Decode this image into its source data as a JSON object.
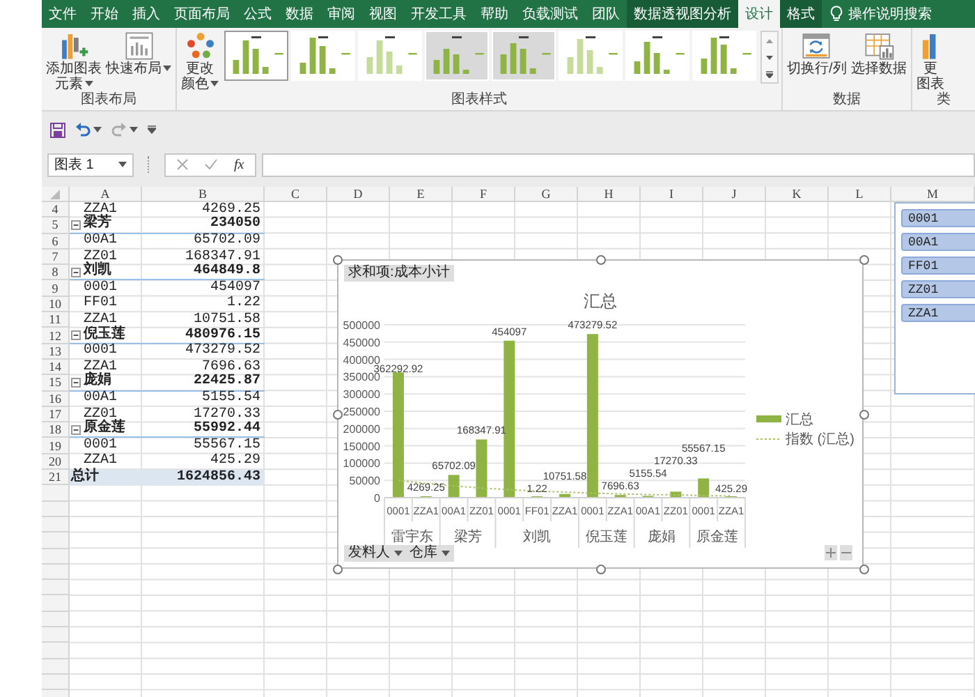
{
  "ribbon_tabs": [
    {
      "label": "文件",
      "selected": false,
      "contextual": false
    },
    {
      "label": "开始",
      "selected": false,
      "contextual": false
    },
    {
      "label": "插入",
      "selected": false,
      "contextual": false
    },
    {
      "label": "页面布局",
      "selected": false,
      "contextual": false
    },
    {
      "label": "公式",
      "selected": false,
      "contextual": false
    },
    {
      "label": "数据",
      "selected": false,
      "contextual": false
    },
    {
      "label": "审阅",
      "selected": false,
      "contextual": false
    },
    {
      "label": "视图",
      "selected": false,
      "contextual": false
    },
    {
      "label": "开发工具",
      "selected": false,
      "contextual": false
    },
    {
      "label": "帮助",
      "selected": false,
      "contextual": false
    },
    {
      "label": "负载测试",
      "selected": false,
      "contextual": false
    },
    {
      "label": "团队",
      "selected": false,
      "contextual": false
    },
    {
      "label": "数据透视图分析",
      "selected": false,
      "contextual": true
    },
    {
      "label": "设计",
      "selected": true,
      "contextual": true
    },
    {
      "label": "格式",
      "selected": false,
      "contextual": true
    }
  ],
  "tell_me": {
    "label": "操作说明搜索"
  },
  "ribbon_groups": [
    {
      "label": "图表布局",
      "buttons": [
        {
          "kind": "add",
          "lines": [
            "添加图表",
            "元素"
          ],
          "dropdown": true
        },
        {
          "kind": "layout",
          "lines": [
            "快速布局"
          ],
          "dropdown": true
        }
      ]
    },
    {
      "label": "图表样式",
      "buttons": [
        {
          "kind": "colors",
          "lines": [
            "更改",
            "颜色"
          ],
          "dropdown": true
        }
      ],
      "styles": [
        {
          "selected": true
        },
        {
          "selected": false
        },
        {
          "selected": false
        },
        {
          "selected": false
        },
        {
          "selected": false
        },
        {
          "selected": false
        },
        {
          "selected": false
        },
        {
          "selected": false
        }
      ]
    },
    {
      "label": "数据",
      "buttons": [
        {
          "kind": "switch",
          "lines": [
            "切换行/列"
          ],
          "dropdown": false
        },
        {
          "kind": "select",
          "lines": [
            "选择数据"
          ],
          "dropdown": false
        }
      ]
    },
    {
      "label": "类",
      "buttons": [
        {
          "kind": "type",
          "lines": [
            "更",
            "图表"
          ],
          "dropdown": false
        }
      ]
    }
  ],
  "formula_bar": {
    "name_box": "图表 1",
    "function_label": "fx"
  },
  "columns": [
    "A",
    "B",
    "C",
    "D",
    "E",
    "F",
    "G",
    "H",
    "I",
    "J",
    "K",
    "L",
    "M"
  ],
  "rows": [
    {
      "number": "4",
      "label": "ZZA1",
      "value": "4269.25",
      "kind": "item"
    },
    {
      "number": "5",
      "label": "梁芳",
      "value": "234050",
      "kind": "group",
      "expanded": true
    },
    {
      "number": "6",
      "label": "00A1",
      "value": "65702.09",
      "kind": "item"
    },
    {
      "number": "7",
      "label": "ZZ01",
      "value": "168347.91",
      "kind": "item"
    },
    {
      "number": "8",
      "label": "刘凯",
      "value": "464849.8",
      "kind": "group",
      "expanded": true
    },
    {
      "number": "9",
      "label": "0001",
      "value": "454097",
      "kind": "item"
    },
    {
      "number": "10",
      "label": "FF01",
      "value": "1.22",
      "kind": "item"
    },
    {
      "number": "11",
      "label": "ZZA1",
      "value": "10751.58",
      "kind": "item"
    },
    {
      "number": "12",
      "label": "倪玉莲",
      "value": "480976.15",
      "kind": "group",
      "expanded": true
    },
    {
      "number": "13",
      "label": "0001",
      "value": "473279.52",
      "kind": "item"
    },
    {
      "number": "14",
      "label": "ZZA1",
      "value": "7696.63",
      "kind": "item"
    },
    {
      "number": "15",
      "label": "庞娟",
      "value": "22425.87",
      "kind": "group",
      "expanded": true
    },
    {
      "number": "16",
      "label": "00A1",
      "value": "5155.54",
      "kind": "item"
    },
    {
      "number": "17",
      "label": "ZZ01",
      "value": "17270.33",
      "kind": "item"
    },
    {
      "number": "18",
      "label": "原金莲",
      "value": "55992.44",
      "kind": "group",
      "expanded": true
    },
    {
      "number": "19",
      "label": "0001",
      "value": "55567.15",
      "kind": "item"
    },
    {
      "number": "20",
      "label": "ZZA1",
      "value": "425.29",
      "kind": "item"
    },
    {
      "number": "21",
      "label": "总计",
      "value": "1624856.43",
      "kind": "total"
    }
  ],
  "chart": {
    "value_field_button": "求和项:成本小计",
    "axis_field_buttons": [
      "发料人",
      "仓库"
    ],
    "category_groups": [
      {
        "label": "雷宇东"
      },
      {
        "label": "梁芳"
      },
      {
        "label": "刘凯"
      },
      {
        "label": "倪玉莲"
      },
      {
        "label": "庞娟"
      },
      {
        "label": "原金莲"
      }
    ],
    "category_group_starts": [
      true,
      false,
      true,
      false,
      true,
      false,
      false,
      true,
      false,
      true,
      false,
      true,
      false
    ],
    "chart_data": {
      "type": "bar",
      "title": "汇总",
      "categories": [
        "0001",
        "ZZA1",
        "00A1",
        "ZZ01",
        "0001",
        "FF01",
        "ZZA1",
        "0001",
        "ZZA1",
        "00A1",
        "ZZ01",
        "0001",
        "ZZA1"
      ],
      "series": [
        {
          "name": "汇总",
          "color": "#8fb443",
          "values": [
            362292.92,
            4269.25,
            65702.09,
            168347.91,
            454097,
            1.22,
            10751.58,
            473279.52,
            7696.63,
            5155.54,
            17270.33,
            55567.15,
            425.29
          ],
          "value_labels": [
            "362292.92",
            "4269.25",
            "65702.09",
            "168347.91",
            "454097",
            "1.22",
            "10751.58",
            "473279.52",
            "7696.63",
            "5155.54",
            "17270.33",
            "55567.15",
            "425.29"
          ]
        },
        {
          "name": "指数 (汇总)",
          "type": "line",
          "line_style": "dotted",
          "color": "#a9c46c",
          "values": [
            50000,
            41000,
            34000,
            28000,
            23000,
            19000,
            16000,
            13000,
            11000,
            9000,
            8000,
            6000,
            5000
          ]
        }
      ],
      "ylim": [
        0,
        500000
      ],
      "yticks": [
        0,
        50000,
        100000,
        150000,
        200000,
        250000,
        300000,
        350000,
        400000,
        450000,
        500000
      ],
      "grid": true,
      "legend": "right"
    }
  },
  "slicer": {
    "items": [
      {
        "label": "0001",
        "selected": true
      },
      {
        "label": "00A1",
        "selected": true
      },
      {
        "label": "FF01",
        "selected": true
      },
      {
        "label": "ZZ01",
        "selected": true
      },
      {
        "label": "ZZA1",
        "selected": true
      }
    ]
  }
}
